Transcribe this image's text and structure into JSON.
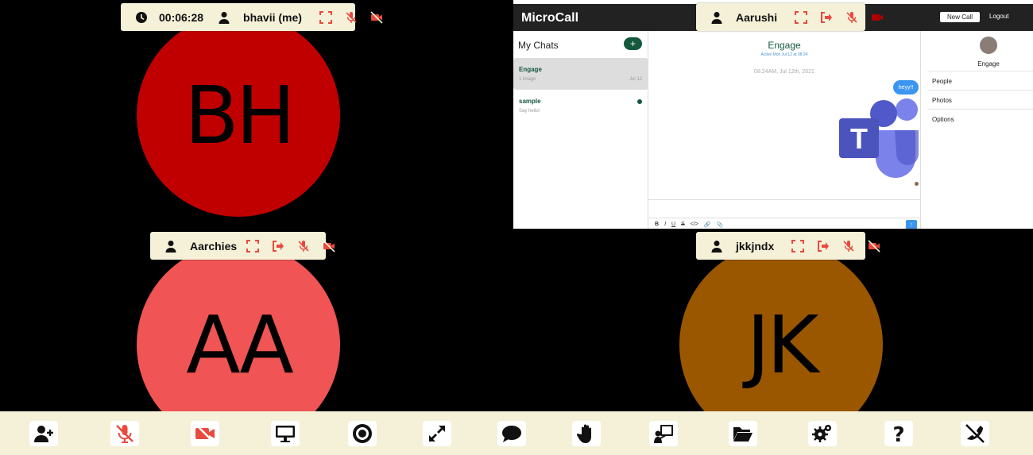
{
  "participants": [
    {
      "name": "bhavii (me)",
      "initials": "BH",
      "color": "#c00000",
      "timer": "00:06:28"
    },
    {
      "name": "Aarushi",
      "initials": "",
      "color": "#000000"
    },
    {
      "name": "Aarchies",
      "initials": "AA",
      "color": "#f05454"
    },
    {
      "name": "jkkjndx",
      "initials": "JK",
      "color": "#9a5700"
    }
  ],
  "shared_app": {
    "logo": "MicroCall",
    "new_call": "New Call",
    "logout": "Logout",
    "chats_title": "My Chats",
    "add_label": "+",
    "chats": [
      {
        "name": "Engage",
        "sub": "1 image",
        "date": "Jul 12"
      },
      {
        "name": "sample",
        "sub": "Say hello!",
        "date": ""
      }
    ],
    "conversation": {
      "title": "Engage",
      "active": "Active Mon Jul 12 at 08:24",
      "stamp": "08:24AM, Jul 12th, 2021",
      "bubble": "heyy!!",
      "toolbar": [
        "B",
        "I",
        "U",
        "S",
        "</>",
        "🔗",
        "📎"
      ],
      "send": "↑"
    },
    "info": {
      "name": "Engage",
      "items": [
        "People",
        "Photos",
        "Options"
      ]
    }
  },
  "colors": {
    "toolbar_bg": "#f4f1d8",
    "icon_red": "#e84a3f",
    "icon_dark": "#111111"
  },
  "toolbar_buttons": [
    "add-participant-icon",
    "mute-mic-icon",
    "camera-off-icon",
    "screen-share-icon",
    "record-icon",
    "fullscreen-icon",
    "chat-icon",
    "raise-hand-icon",
    "presenter-icon",
    "folder-icon",
    "settings-icon",
    "help-icon",
    "end-call-icon"
  ]
}
